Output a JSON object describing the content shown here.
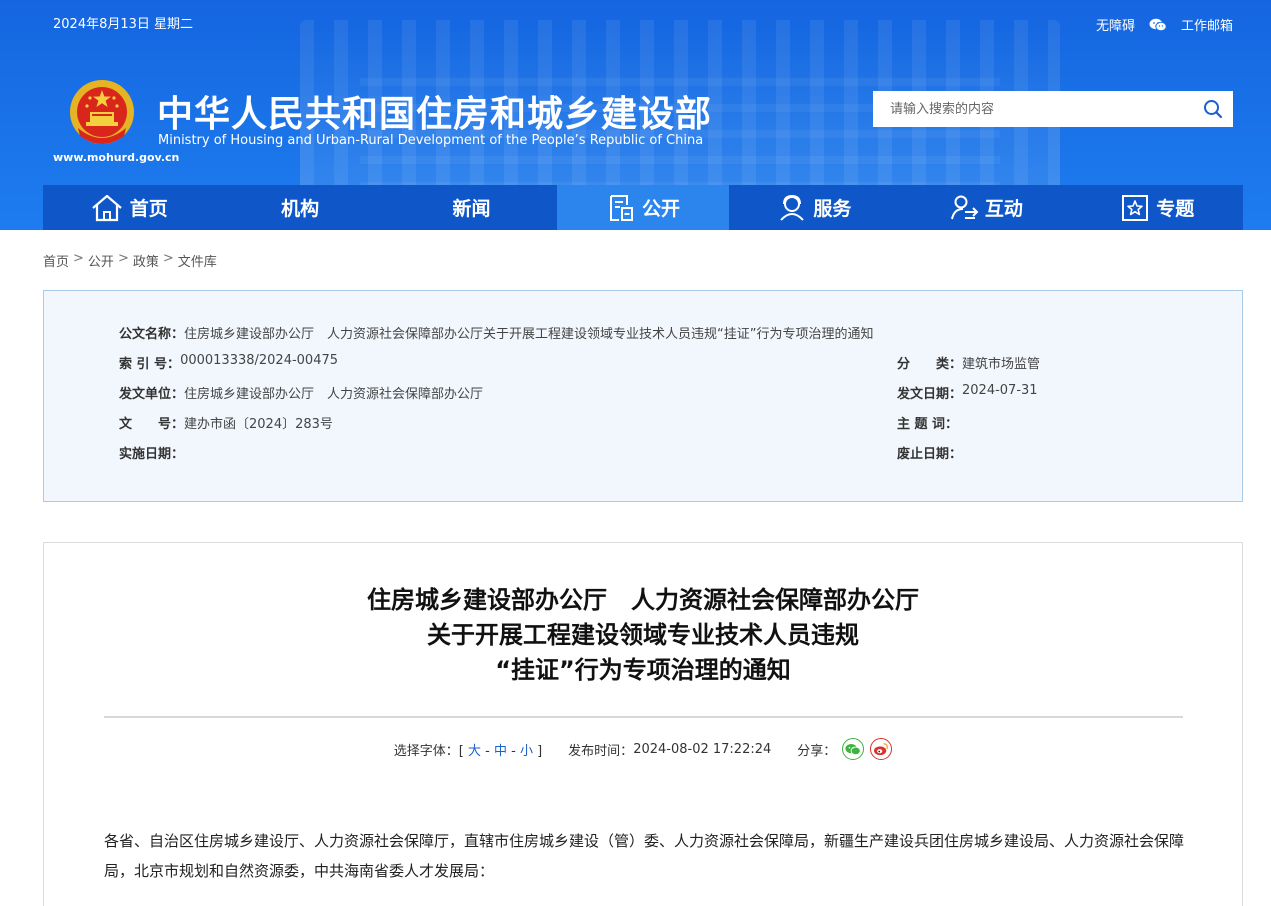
{
  "header": {
    "date": "2024年8月13日 星期二",
    "accessibility": "无障碍",
    "work_mail": "工作邮箱",
    "title": "中华人民共和国住房和城乡建设部",
    "subtitle": "Ministry of Housing and Urban-Rural Development of the People’s Republic of China",
    "url": "www.mohurd.gov.cn",
    "search_placeholder": "请输入搜索的内容"
  },
  "nav": [
    {
      "label": "首页",
      "icon": "home-icon"
    },
    {
      "label": "机构",
      "icon": ""
    },
    {
      "label": "新闻",
      "icon": ""
    },
    {
      "label": "公开",
      "icon": "document-icon",
      "active": true
    },
    {
      "label": "服务",
      "icon": "user-service-icon"
    },
    {
      "label": "互动",
      "icon": "interaction-icon"
    },
    {
      "label": "专题",
      "icon": "star-box-icon"
    }
  ],
  "breadcrumb": [
    "首页",
    "公开",
    "政策",
    "文件库"
  ],
  "meta": {
    "name_label": "公文名称：",
    "name_value": "住房城乡建设部办公厅　人力资源社会保障部办公厅关于开展工程建设领域专业技术人员违规“挂证”行为专项治理的通知",
    "index_label": "索 引 号：",
    "index_value": "000013338/2024-00475",
    "category_label": "分　　类：",
    "category_value": "建筑市场监管",
    "issuer_label": "发文单位：",
    "issuer_value": "住房城乡建设部办公厅　人力资源社会保障部办公厅",
    "issue_date_label": "发文日期：",
    "issue_date_value": "2024-07-31",
    "doc_no_label": "文　　号：",
    "doc_no_value": "建办市函〔2024〕283号",
    "keywords_label": "主 题 词：",
    "keywords_value": "",
    "effective_label": "实施日期：",
    "effective_value": "",
    "abolish_label": "废止日期：",
    "abolish_value": ""
  },
  "article": {
    "title_line1": "住房城乡建设部办公厅　人力资源社会保障部办公厅",
    "title_line2": "关于开展工程建设领域专业技术人员违规",
    "title_line3": "“挂证”行为专项治理的通知",
    "font_label": "选择字体：[",
    "font_large": "大",
    "font_medium": "中",
    "font_small": "小",
    "font_end": "]",
    "dash": "-",
    "publish_label": "发布时间：",
    "publish_time": "2024-08-02 17:22:24",
    "share_label": "分享：",
    "body": "各省、自治区住房城乡建设厅、人力资源社会保障厅，直辖市住房城乡建设（管）委、人力资源社会保障局，新疆生产建设兵团住房城乡建设局、人力资源社会保障局，北京市规划和自然资源委，中共海南省委人才发展局："
  },
  "colors": {
    "header_blue": "#1a73e8",
    "nav_blue": "#0f57c9",
    "nav_active": "#2c85ec",
    "meta_bg": "#f2f7fd",
    "link_blue": "#1a62c9"
  }
}
